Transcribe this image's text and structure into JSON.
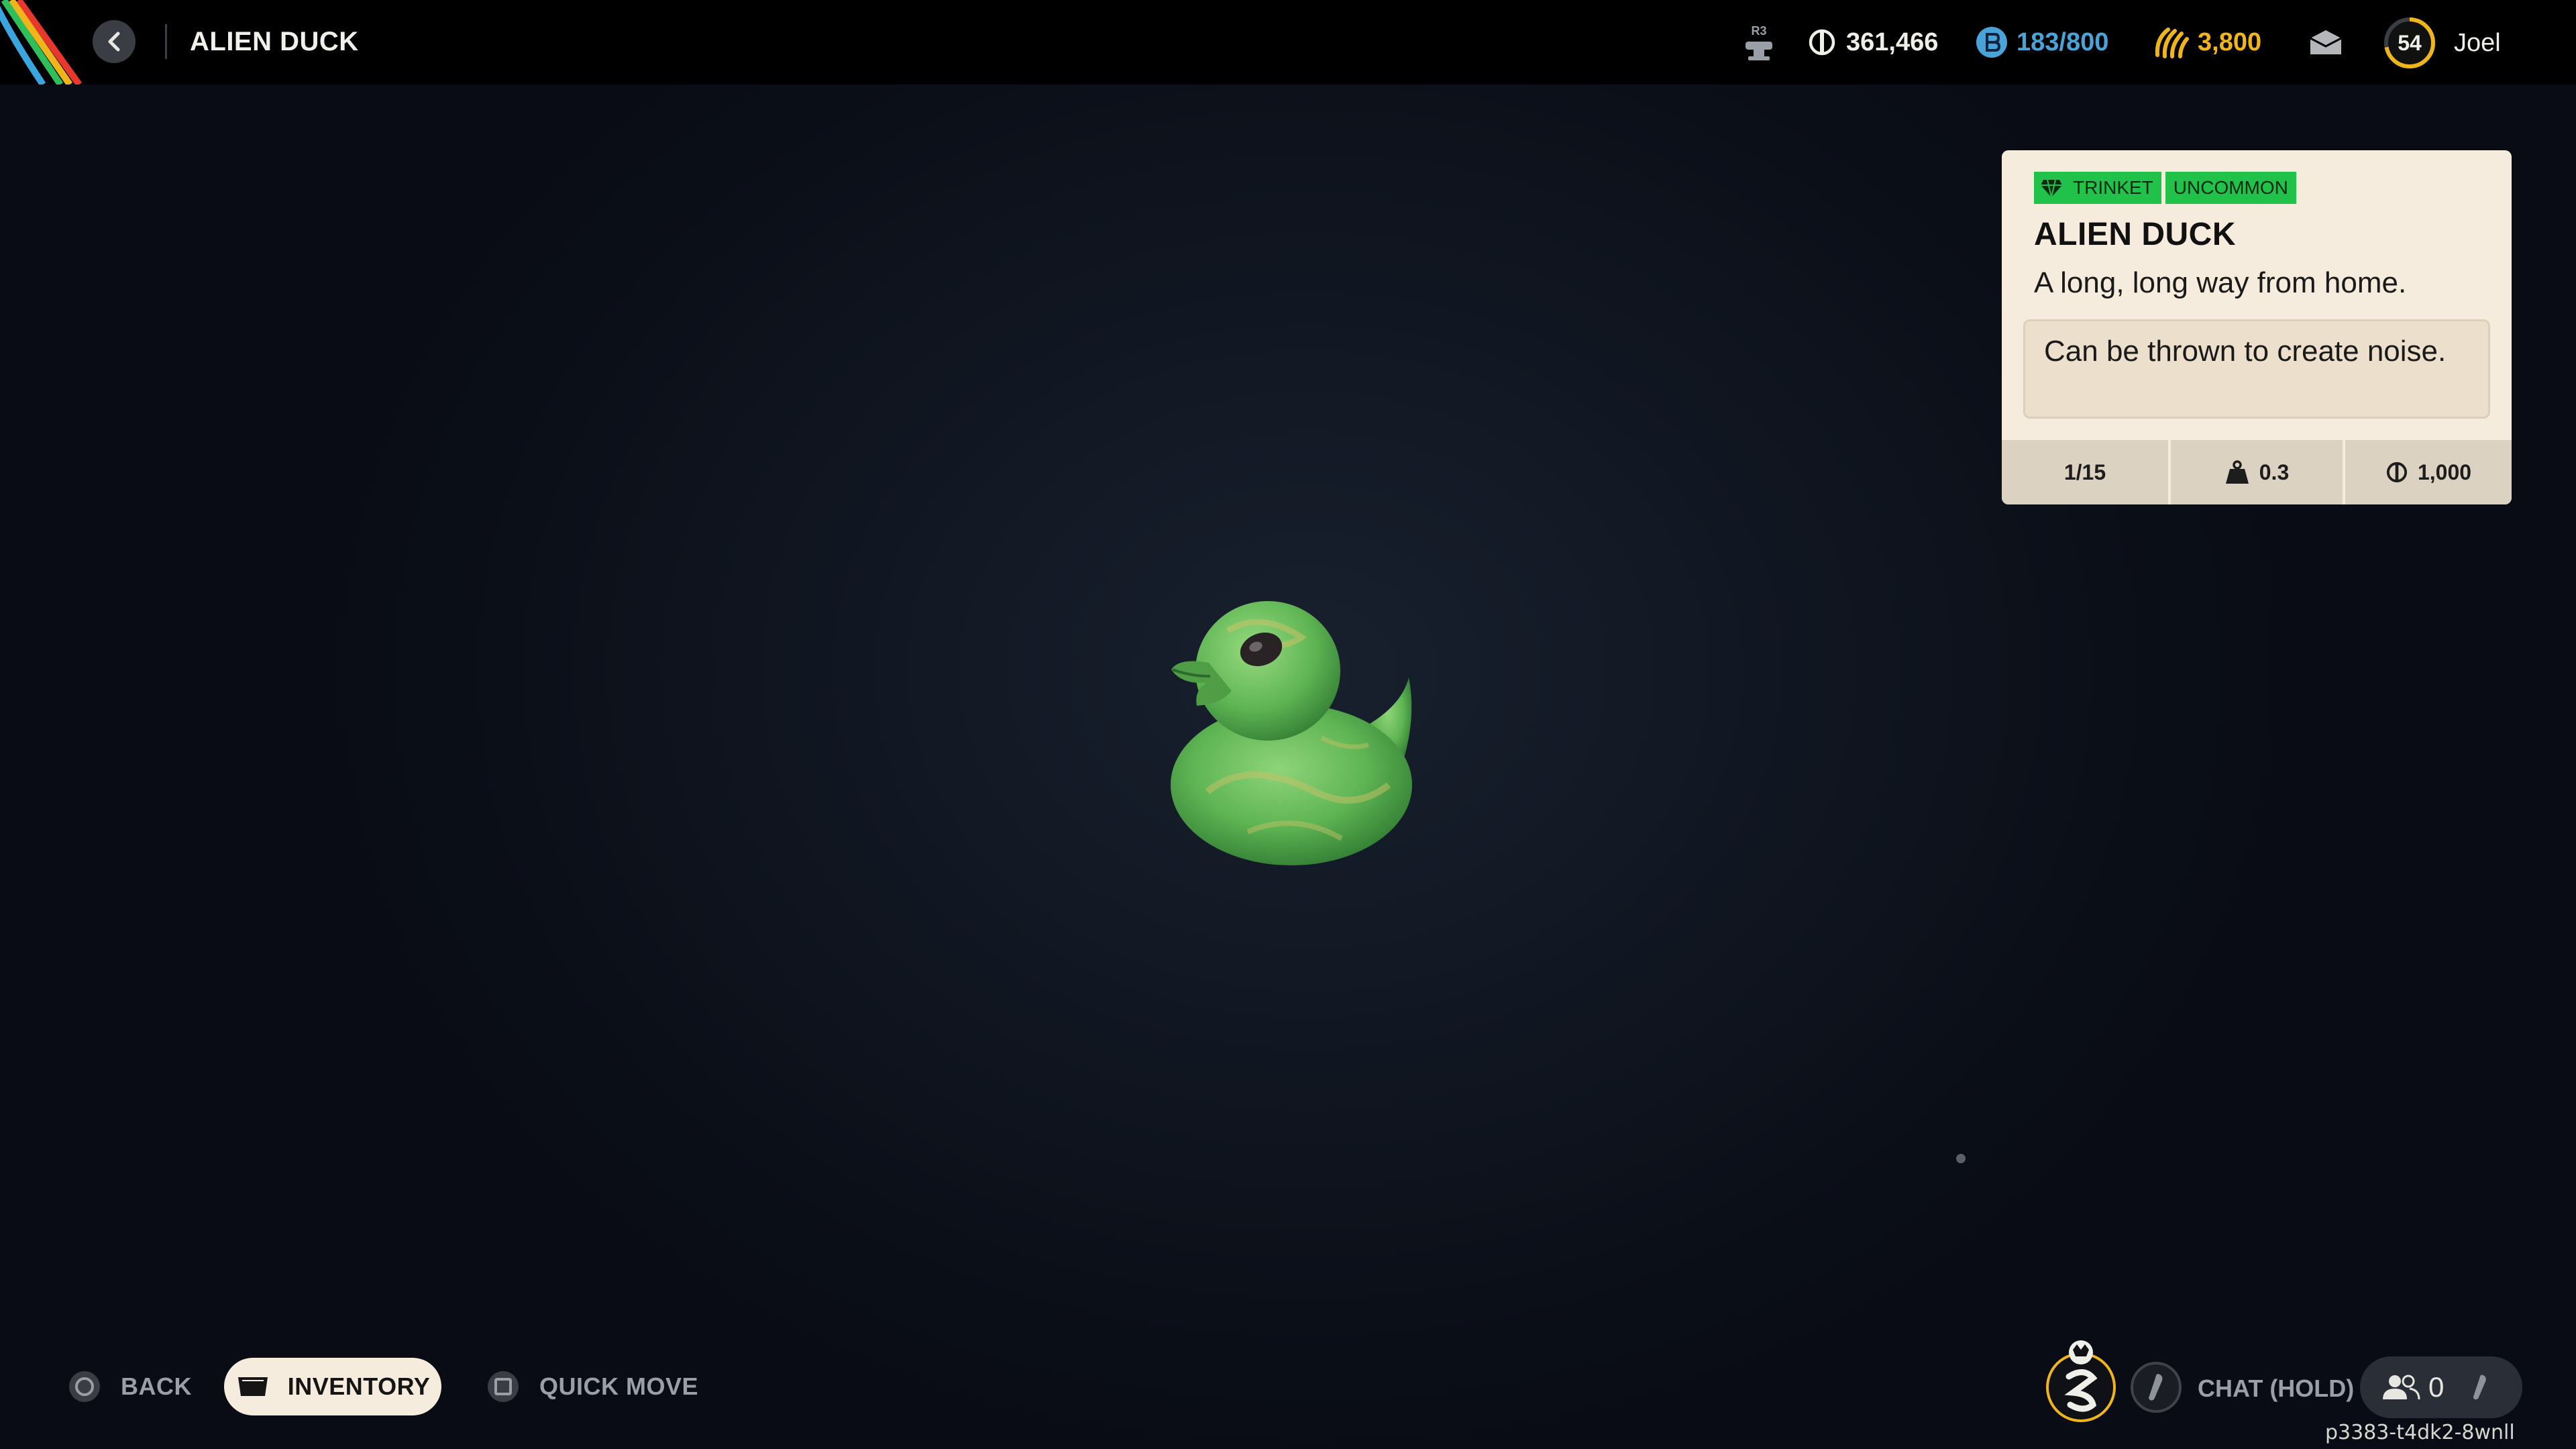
{
  "header": {
    "title": "ALIEN DUCK",
    "r3_label": "R3",
    "coins": "361,466",
    "tokens": "183/800",
    "gold": "3,800",
    "level": "54",
    "player_name": "Joel"
  },
  "item": {
    "tags": [
      "TRINKET",
      "UNCOMMON"
    ],
    "name": "ALIEN DUCK",
    "flavor": "A long, long way from home.",
    "effect": "Can be thrown to create noise.",
    "stack": "1/15",
    "weight": "0.3",
    "value": "1,000"
  },
  "footer": {
    "back_label": "BACK",
    "inventory_label": "INVENTORY",
    "quick_move_label": "QUICK MOVE",
    "chat_label": "CHAT (HOLD)",
    "party_count": "0",
    "session_id": "p3383-t4dk2-8wnll"
  },
  "colors": {
    "tag_green": "#21c24a",
    "card_bg": "#f6ecdd",
    "token_blue": "#4aa3d8",
    "gold_yellow": "#f1b51c",
    "level_ring": "#f1b51c"
  },
  "icons": {
    "back": "chevron-left-icon",
    "r3": "stick-r3-icon",
    "coins": "coin-icon",
    "tokens": "token-icon",
    "gold": "gold-icon",
    "mail": "mail-icon",
    "rarity": "gem-icon",
    "weight": "weight-icon",
    "value": "coin-icon",
    "back_button": "circle-button-icon",
    "inventory_button": "touchpad-icon",
    "quick_move_button": "square-button-icon",
    "emblem": "faction-emblem-icon",
    "chat": "stick-icon",
    "party": "party-icon"
  },
  "level_progress": 0.72
}
